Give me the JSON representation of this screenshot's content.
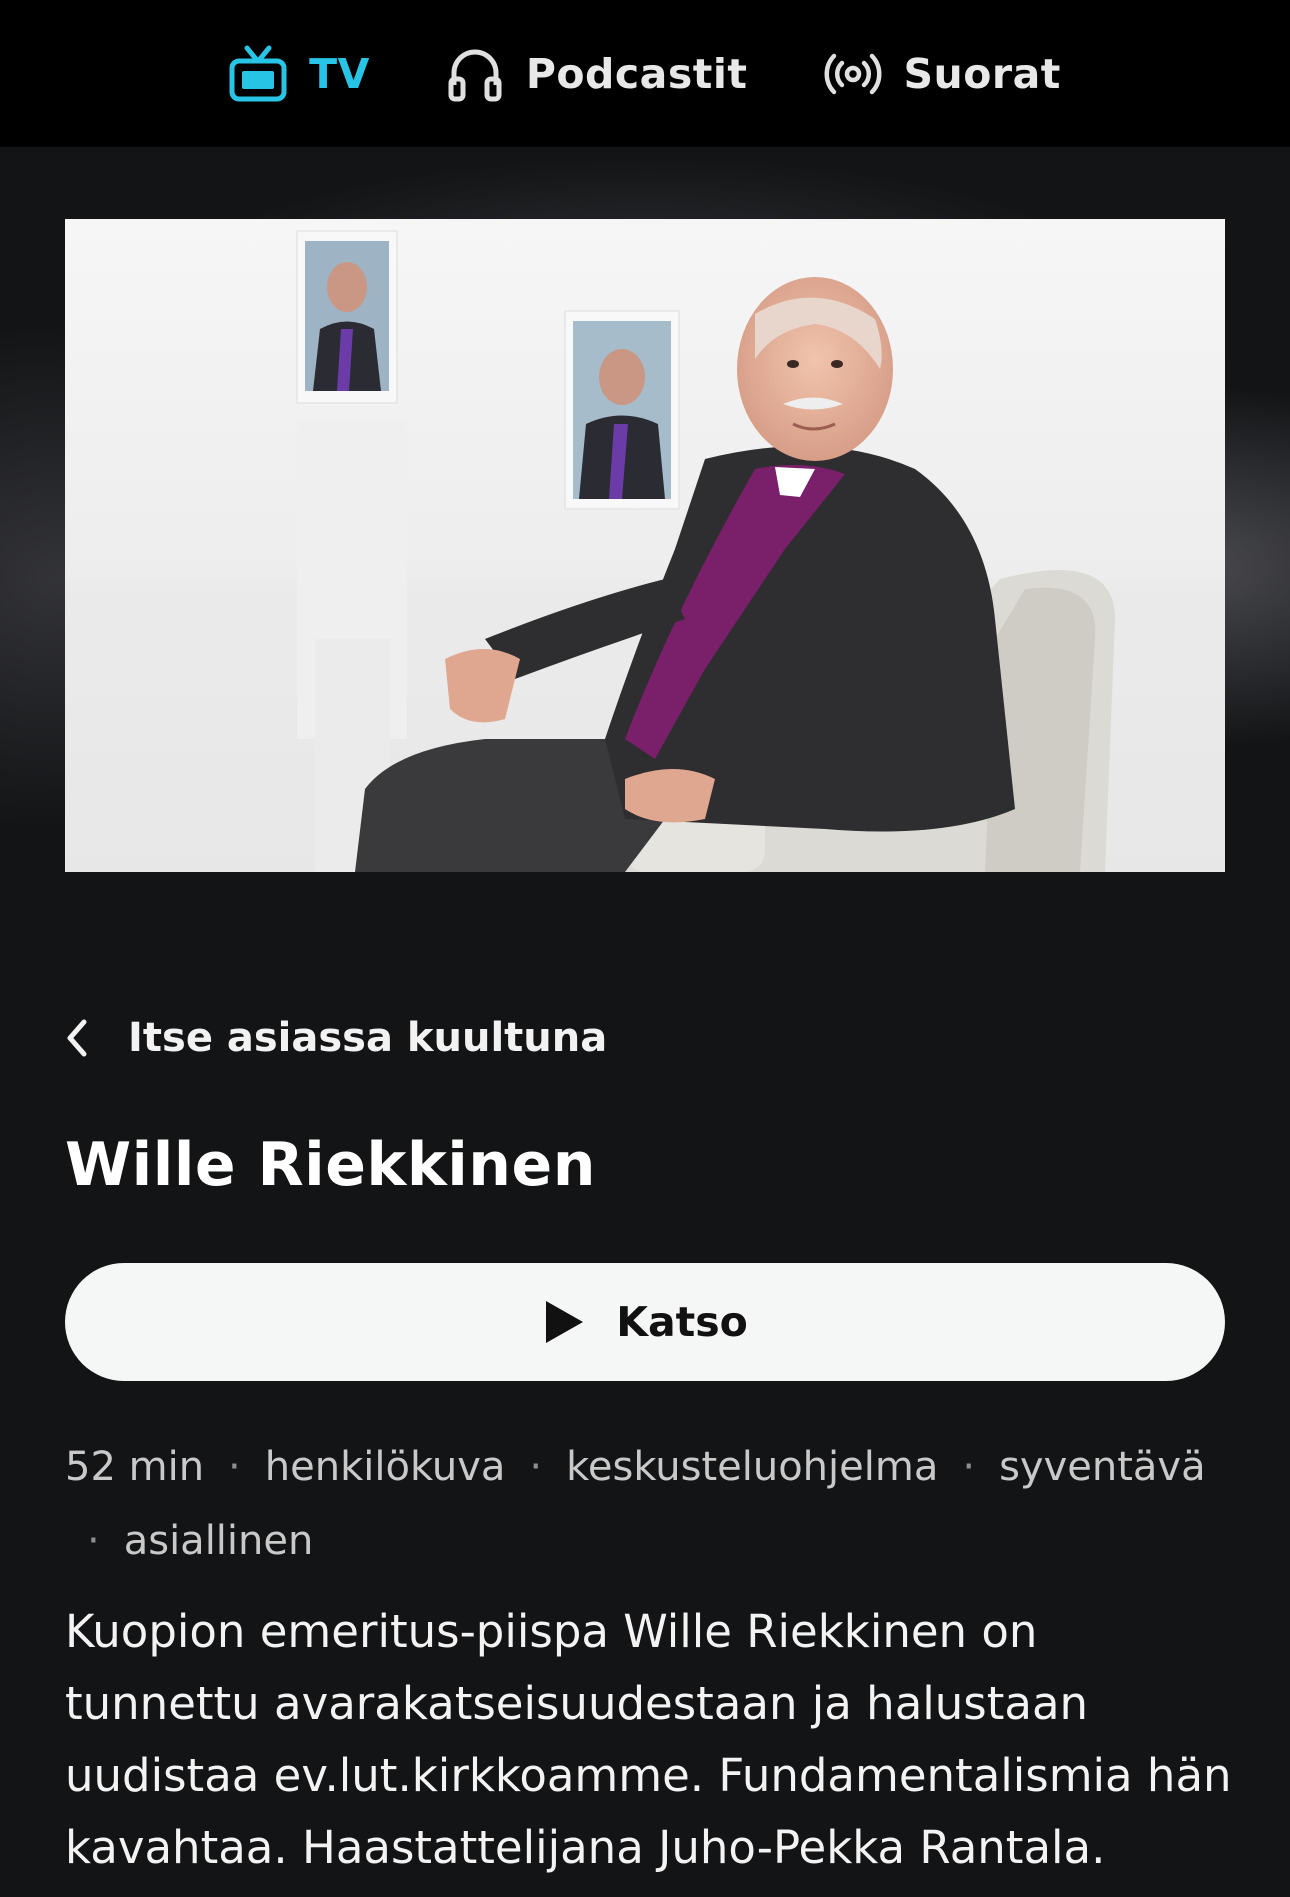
{
  "nav": {
    "items": [
      {
        "label": "TV",
        "icon": "tv-icon",
        "active": true
      },
      {
        "label": "Podcastit",
        "icon": "headphones-icon",
        "active": false
      },
      {
        "label": "Suorat",
        "icon": "live-broadcast-icon",
        "active": false
      }
    ],
    "accent_color": "#27c4e6"
  },
  "breadcrumb": {
    "label": "Itse asiassa kuultuna",
    "icon": "chevron-left-icon"
  },
  "title": "Wille Riekkinen",
  "watch_button": {
    "label": "Katso",
    "icon": "play-icon"
  },
  "meta": {
    "duration": "52 min",
    "tags": [
      "henkilökuva",
      "keskusteluohjelma",
      "syventävä",
      "asiallinen"
    ],
    "separator": "·"
  },
  "description": "Kuopion emeritus-piispa Wille Riekkinen on tunnettu avarakatseisuudestaan ja halustaan uudistaa ev.lut.kirkkoamme. Fundamentalismia hän kavahtaa. Haastattelijana Juho-Pekka Rantala."
}
